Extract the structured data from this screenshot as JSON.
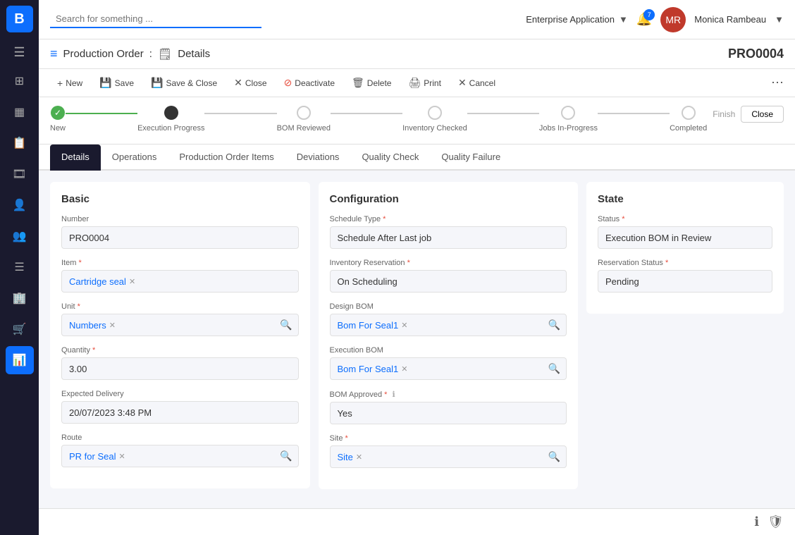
{
  "sidebar": {
    "logo": "B",
    "items": [
      {
        "id": "dashboard",
        "icon": "⊞",
        "active": false
      },
      {
        "id": "calendar",
        "icon": "📅",
        "active": false
      },
      {
        "id": "report",
        "icon": "📄",
        "active": false
      },
      {
        "id": "video",
        "icon": "🎥",
        "active": false
      },
      {
        "id": "person",
        "icon": "👤",
        "active": false
      },
      {
        "id": "users",
        "icon": "👥",
        "active": false
      },
      {
        "id": "list",
        "icon": "☰",
        "active": false
      },
      {
        "id": "building",
        "icon": "🏢",
        "active": false
      },
      {
        "id": "cart",
        "icon": "🛒",
        "active": false
      },
      {
        "id": "chart",
        "icon": "📊",
        "active": true
      }
    ]
  },
  "topbar": {
    "search_placeholder": "Search for something ...",
    "app_name": "Enterprise Application",
    "notif_count": "7",
    "user_name": "Monica Rambeau",
    "user_avatar_text": "MR"
  },
  "page_header": {
    "module": "Production Order",
    "separator": ":",
    "sub_title": "Details",
    "record_id": "PRO0004"
  },
  "toolbar": {
    "buttons": [
      {
        "id": "new",
        "label": "New",
        "icon": "+"
      },
      {
        "id": "save",
        "label": "Save",
        "icon": "💾"
      },
      {
        "id": "save-close",
        "label": "Save & Close",
        "icon": "💾"
      },
      {
        "id": "close",
        "label": "Close",
        "icon": "✕"
      },
      {
        "id": "deactivate",
        "label": "Deactivate",
        "icon": "🚫"
      },
      {
        "id": "delete",
        "label": "Delete",
        "icon": "🗑"
      },
      {
        "id": "print",
        "label": "Print",
        "icon": "🖨"
      },
      {
        "id": "cancel",
        "label": "Cancel",
        "icon": "✕"
      }
    ],
    "more": "⋯"
  },
  "progress": {
    "steps": [
      {
        "label": "New",
        "state": "done"
      },
      {
        "label": "Execution Progress",
        "state": "active"
      },
      {
        "label": "BOM Reviewed",
        "state": "gray"
      },
      {
        "label": "Inventory Checked",
        "state": "gray"
      },
      {
        "label": "Jobs In-Progress",
        "state": "gray"
      },
      {
        "label": "Completed",
        "state": "gray"
      }
    ],
    "finish_label": "Finish",
    "close_label": "Close"
  },
  "tabs": [
    {
      "id": "details",
      "label": "Details",
      "active": true
    },
    {
      "id": "operations",
      "label": "Operations",
      "active": false
    },
    {
      "id": "production-order-items",
      "label": "Production Order Items",
      "active": false
    },
    {
      "id": "deviations",
      "label": "Deviations",
      "active": false
    },
    {
      "id": "quality-check",
      "label": "Quality Check",
      "active": false
    },
    {
      "id": "quality-failure",
      "label": "Quality Failure",
      "active": false
    }
  ],
  "form": {
    "basic": {
      "title": "Basic",
      "number_label": "Number",
      "number_value": "PRO0004",
      "item_label": "Item",
      "item_value": "Cartridge seal",
      "unit_label": "Unit",
      "unit_value": "Numbers",
      "quantity_label": "Quantity",
      "quantity_value": "3.00",
      "expected_delivery_label": "Expected Delivery",
      "expected_delivery_value": "20/07/2023 3:48 PM",
      "route_label": "Route",
      "route_value": "PR for Seal"
    },
    "configuration": {
      "title": "Configuration",
      "schedule_type_label": "Schedule Type",
      "schedule_type_value": "Schedule After Last job",
      "inventory_reservation_label": "Inventory Reservation",
      "inventory_reservation_value": "On Scheduling",
      "design_bom_label": "Design BOM",
      "design_bom_value": "Bom For Seal1",
      "execution_bom_label": "Execution BOM",
      "execution_bom_value": "Bom For Seal1",
      "bom_approved_label": "BOM Approved",
      "bom_approved_value": "Yes",
      "site_label": "Site",
      "site_value": "Site"
    },
    "state": {
      "title": "State",
      "status_label": "Status",
      "status_value": "Execution BOM in Review",
      "reservation_status_label": "Reservation Status",
      "reservation_status_value": "Pending"
    }
  },
  "bottom_icons": [
    "ℹ",
    "🛡"
  ]
}
